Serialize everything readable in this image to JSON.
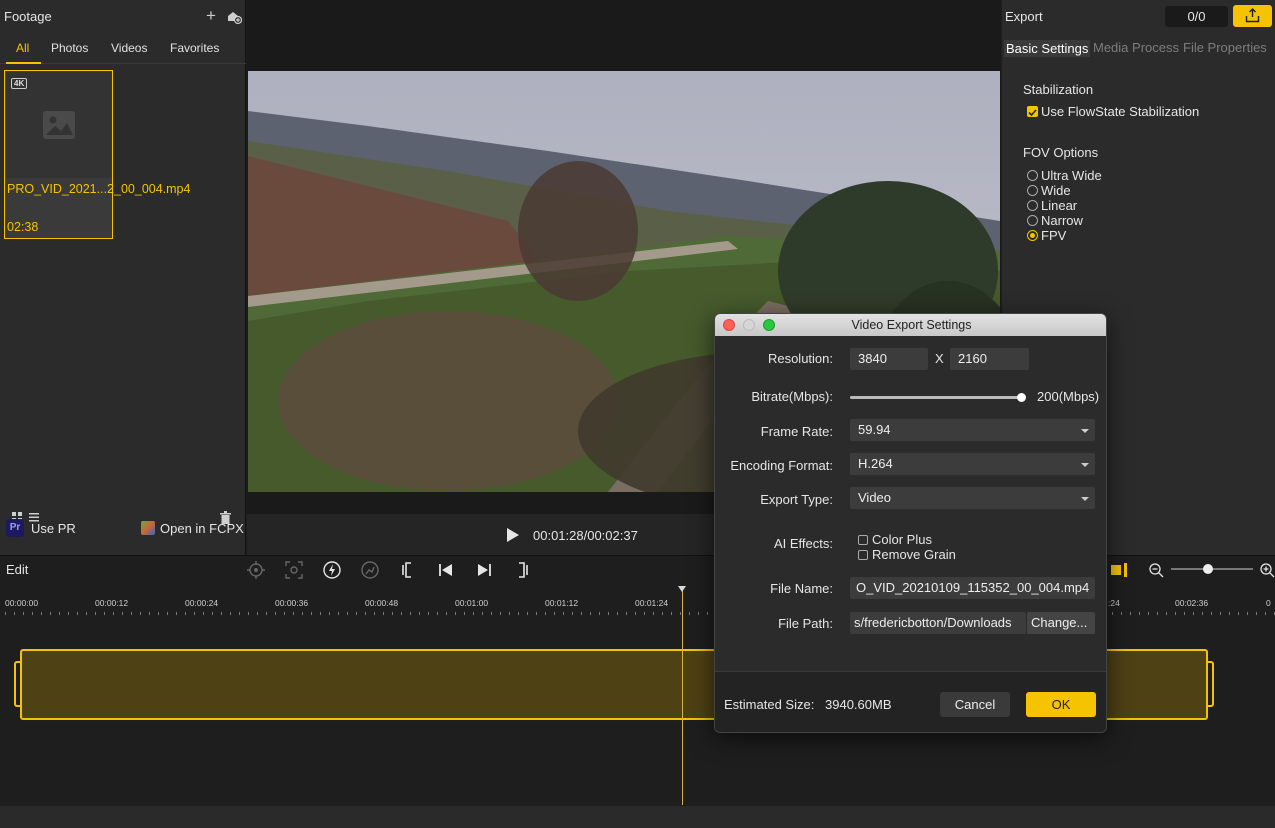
{
  "left": {
    "title": "Footage",
    "tabs": [
      "All",
      "Photos",
      "Videos",
      "Favorites"
    ],
    "clip": {
      "badge": "4K",
      "name": "PRO_VID_2021...2_00_004.mp4",
      "duration": "02:38"
    },
    "use_pr": "Use PR",
    "open_fcpx": "Open in FCPX",
    "pr_badge": "Pr"
  },
  "preview": {
    "timecode": "00:01:28/00:02:37"
  },
  "right": {
    "title": "Export",
    "counter": "0/0",
    "tabs": [
      "Basic Settings",
      "Media Process",
      "File Properties"
    ],
    "stabilization_title": "Stabilization",
    "stabilization_option": "Use FlowState Stabilization",
    "fov_title": "FOV Options",
    "fov_options": [
      "Ultra Wide",
      "Wide",
      "Linear",
      "Narrow",
      "FPV"
    ],
    "fov_selected": "FPV"
  },
  "timeline": {
    "edit_label": "Edit",
    "ticks": [
      "00:00:00",
      "00:00:12",
      "00:00:24",
      "00:00:36",
      "00:00:48",
      "00:01:00",
      "00:01:12",
      "00:01:24",
      ":24",
      "00:02:36",
      "0"
    ]
  },
  "dialog": {
    "title": "Video Export Settings",
    "resolution_label": "Resolution:",
    "res_width": "3840",
    "res_x": "X",
    "res_height": "2160",
    "bitrate_label": "Bitrate(Mbps):",
    "bitrate_value": "200(Mbps)",
    "bitrate_level": 1.0,
    "framerate_label": "Frame Rate:",
    "framerate_value": "59.94",
    "encoding_label": "Encoding Format:",
    "encoding_value": "H.264",
    "export_type_label": "Export Type:",
    "export_type_value": "Video",
    "ai_label": "AI Effects:",
    "ai_options": [
      "Color Plus",
      "Remove Grain"
    ],
    "filename_label": "File Name:",
    "filename_value": "O_VID_20210109_115352_00_004.mp4",
    "filepath_label": "File Path:",
    "filepath_value": "s/fredericbotton/Downloads",
    "change_label": "Change...",
    "estimated_label": "Estimated Size:",
    "estimated_value": "3940.60MB",
    "cancel_label": "Cancel",
    "ok_label": "OK"
  },
  "colors": {
    "accent": "#f5c300",
    "panel": "#2b2b2b",
    "background": "#1e1e1e"
  }
}
